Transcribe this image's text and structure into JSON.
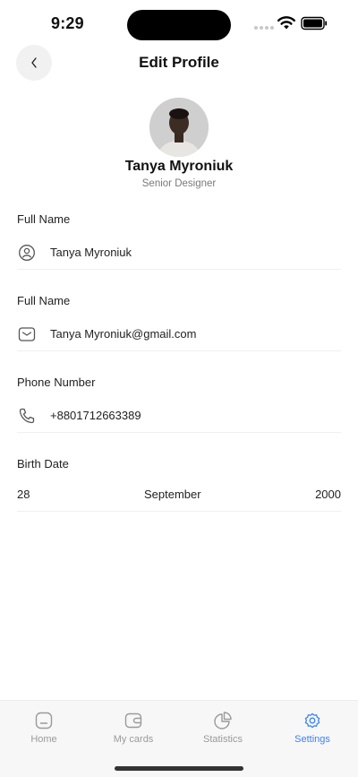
{
  "status_bar": {
    "time": "9:29"
  },
  "header": {
    "title": "Edit Profile",
    "back_icon": "chevron-left-icon"
  },
  "profile": {
    "name": "Tanya Myroniuk",
    "role": "Senior Designer"
  },
  "form": {
    "full_name": {
      "label": "Full Name",
      "value": "Tanya Myroniuk",
      "icon": "user-circle-icon"
    },
    "email": {
      "label": "Full Name",
      "value": "Tanya Myroniuk@gmail.com",
      "icon": "mail-icon"
    },
    "phone": {
      "label": "Phone Number",
      "value": "+8801712663389",
      "icon": "phone-icon"
    },
    "birth_date": {
      "label": "Birth Date",
      "day": "28",
      "month": "September",
      "year": "2000"
    }
  },
  "tab_bar": {
    "tabs": [
      {
        "label": "Home",
        "icon": "home-icon",
        "active": false
      },
      {
        "label": "My cards",
        "icon": "wallet-icon",
        "active": false
      },
      {
        "label": "Statistics",
        "icon": "pie-chart-icon",
        "active": false
      },
      {
        "label": "Settings",
        "icon": "gear-icon",
        "active": true
      }
    ]
  },
  "colors": {
    "accent": "#3b82f6",
    "inactive": "#9a9a9a",
    "tab_bar_bg": "#f7f7f7"
  }
}
